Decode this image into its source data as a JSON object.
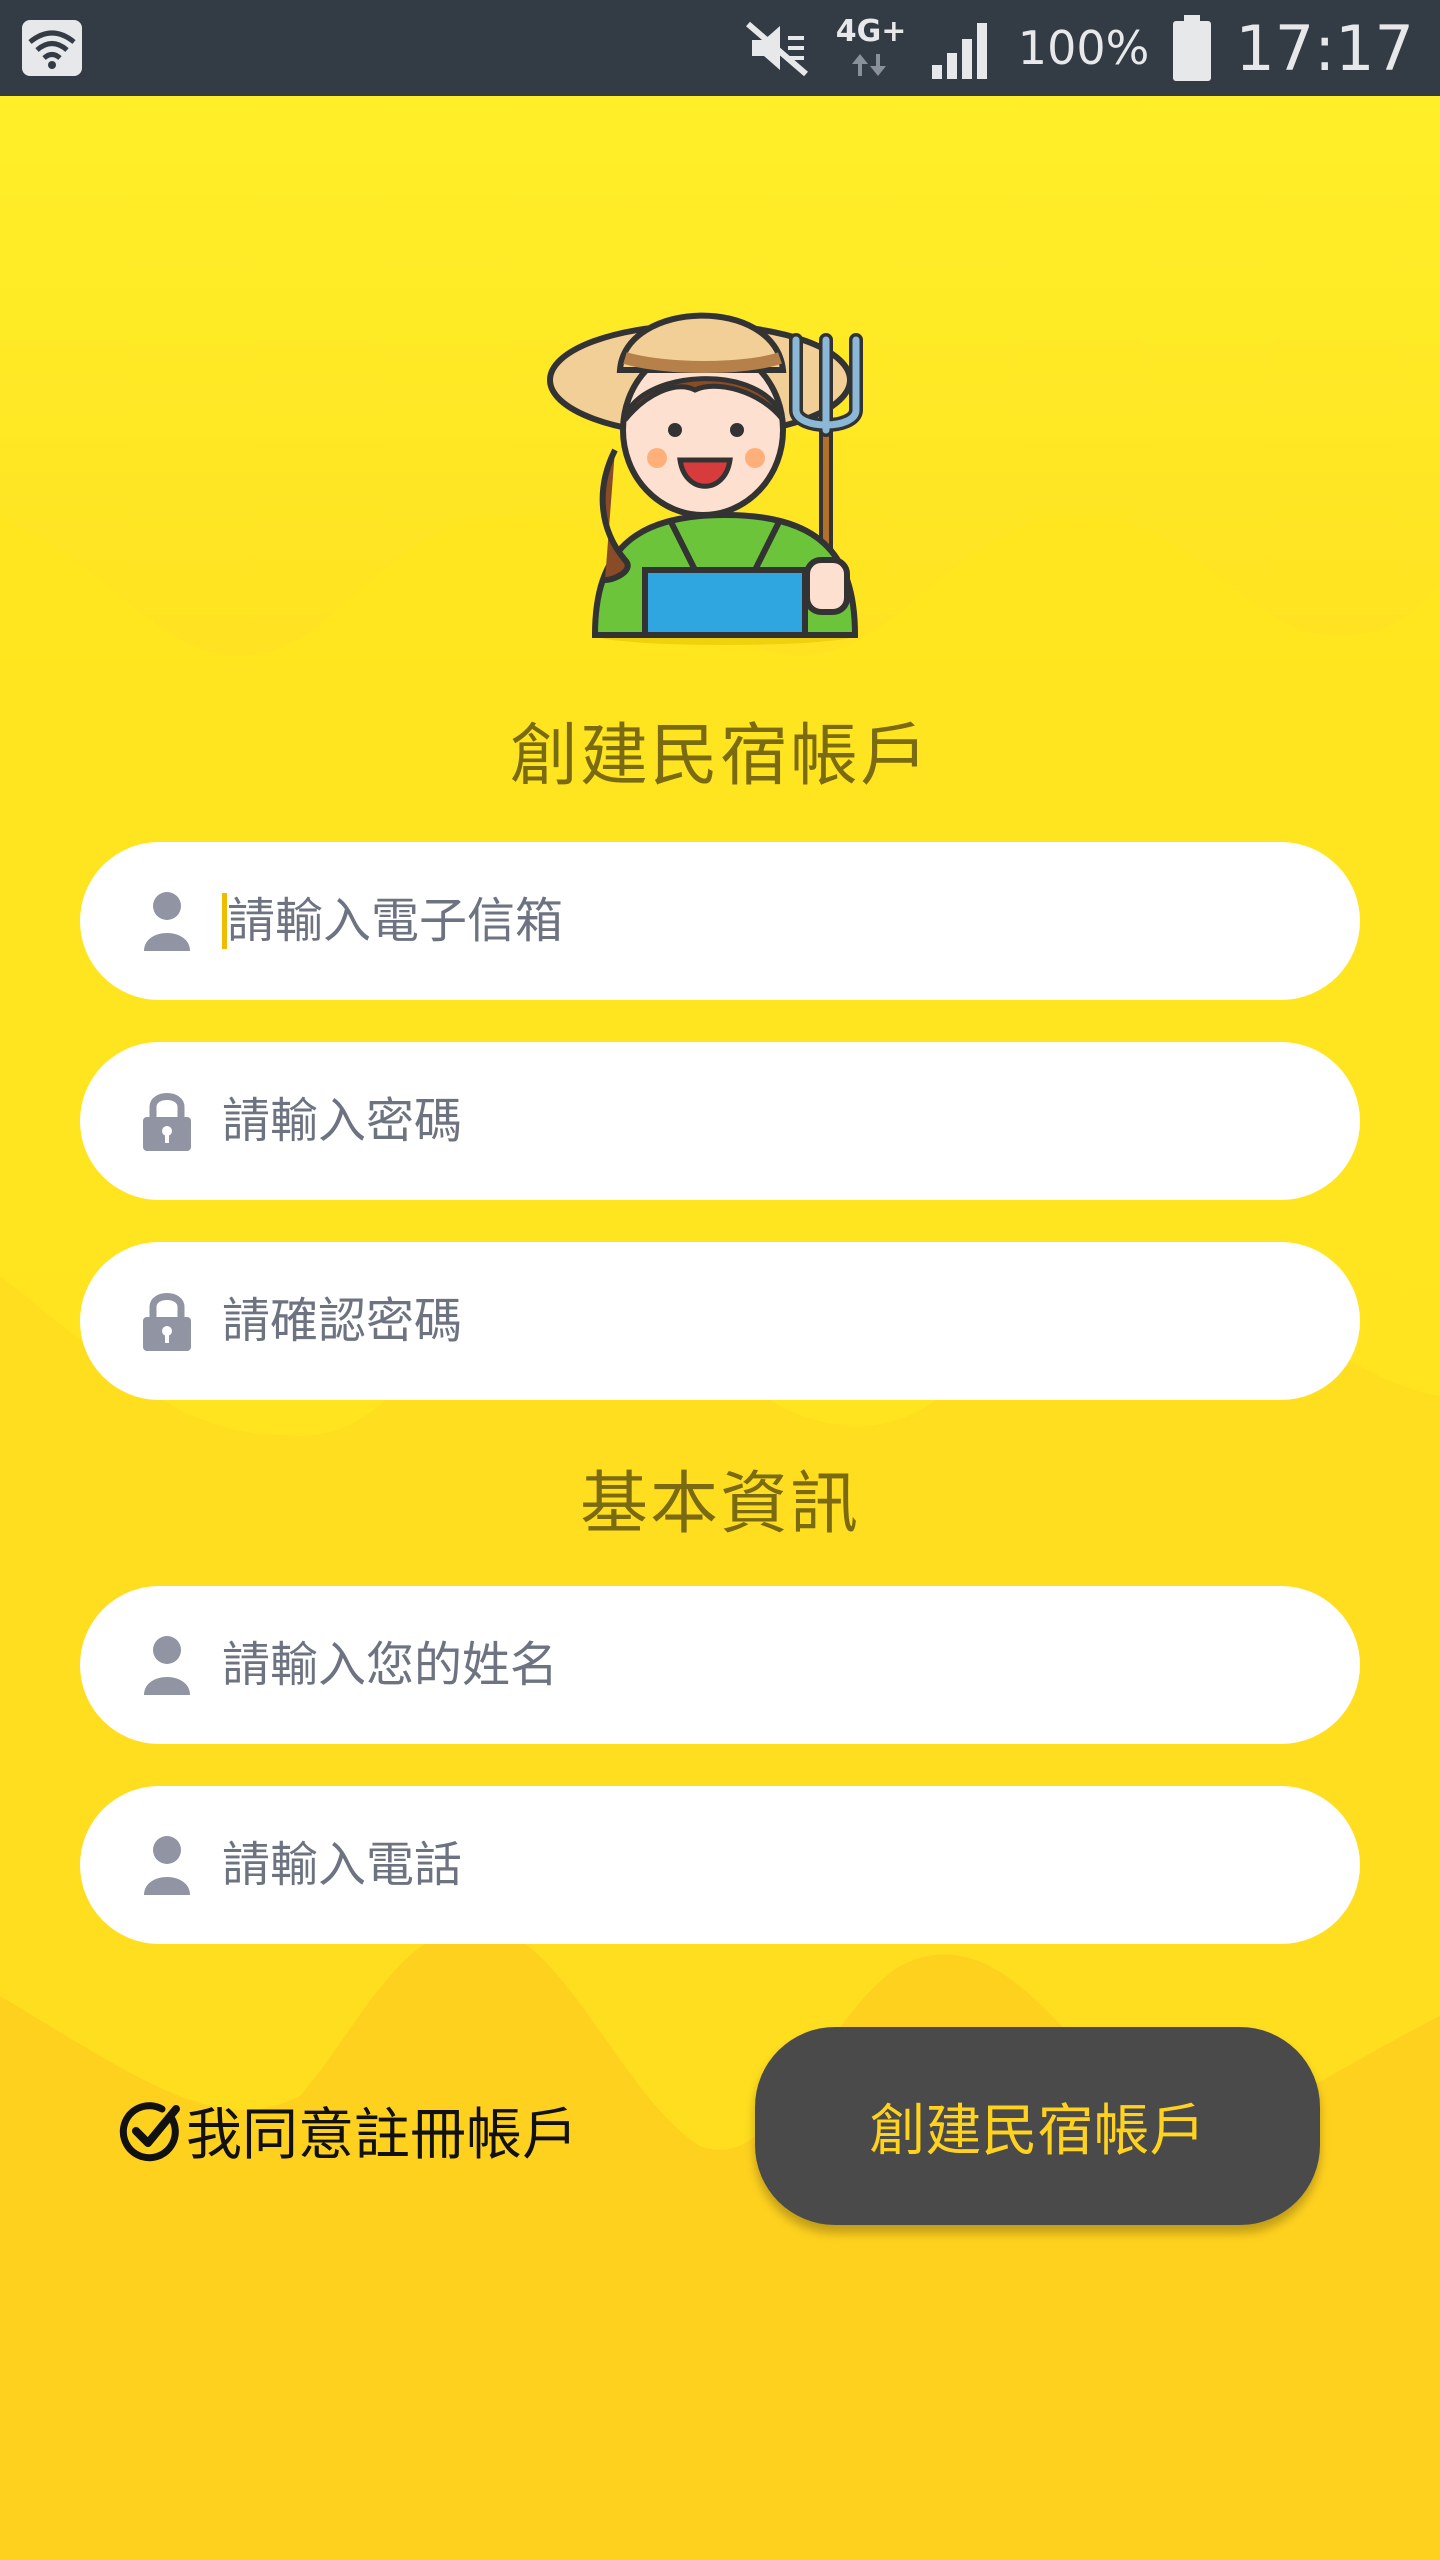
{
  "status_bar": {
    "network": "4G+",
    "battery_percent": "100%",
    "time": "17:17"
  },
  "account": {
    "title": "創建民宿帳戶",
    "email_placeholder": "請輸入電子信箱",
    "password_placeholder": "請輸入密碼",
    "confirm_placeholder": "請確認密碼"
  },
  "profile": {
    "title": "基本資訊",
    "name_placeholder": "請輸入您的姓名",
    "phone_placeholder": "請輸入電話"
  },
  "agree": {
    "label": "我同意註冊帳戶",
    "checked": true
  },
  "submit_label": "創建民宿帳戶",
  "colors": {
    "background_top": "#fff12a",
    "background_bottom": "#ffc820",
    "button": "#4a4a4a",
    "button_text": "#ffd21e",
    "title_text": "#7a6a12",
    "field_icon": "#9094a3"
  }
}
